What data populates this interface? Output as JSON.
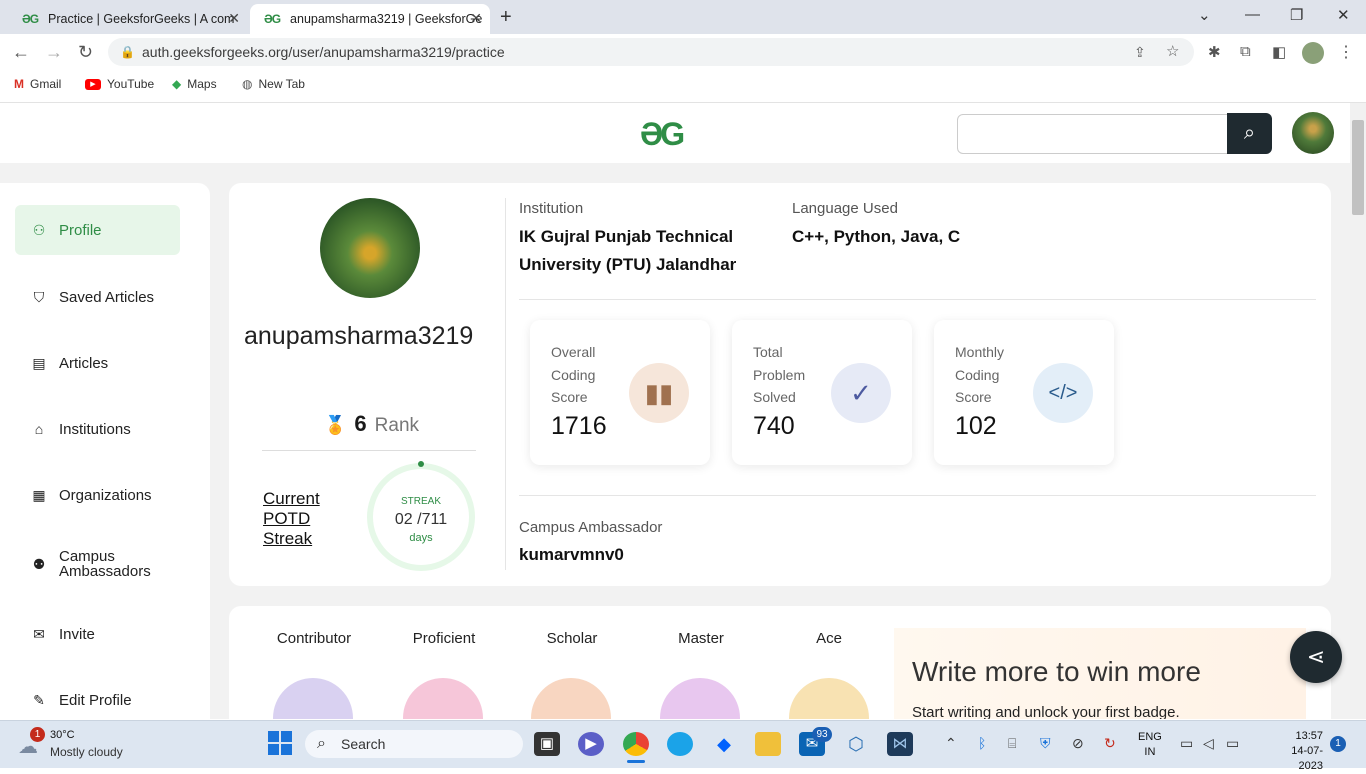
{
  "browser": {
    "tabs": [
      {
        "title": "Practice | GeeksforGeeks | A com",
        "favicon": "gfg-icon",
        "active": false
      },
      {
        "title": "anupamsharma3219 | GeeksforGe",
        "favicon": "gfg-icon",
        "active": true
      }
    ],
    "new_tab_symbol": "+",
    "url": "auth.geeksforgeeks.org/user/anupamsharma3219/practice",
    "bookmarks": [
      {
        "label": "Gmail",
        "icon": "gmail-icon"
      },
      {
        "label": "YouTube",
        "icon": "youtube-icon"
      },
      {
        "label": "Maps",
        "icon": "maps-icon"
      },
      {
        "label": "New Tab",
        "icon": "globe-icon"
      }
    ]
  },
  "site": {
    "logo_text": "ƏG",
    "search_placeholder": ""
  },
  "sidebar": {
    "items": [
      {
        "label": "Profile",
        "icon": "person-icon",
        "active": true
      },
      {
        "label": "Saved Articles",
        "icon": "bookmark-icon",
        "active": false
      },
      {
        "label": "Articles",
        "icon": "document-icon",
        "active": false
      },
      {
        "label": "Institutions",
        "icon": "graduation-cap-icon",
        "active": false
      },
      {
        "label": "Organizations",
        "icon": "building-icon",
        "active": false
      },
      {
        "label": "Campus Ambassadors",
        "icon": "people-icon",
        "active": false
      },
      {
        "label": "Invite",
        "icon": "mail-icon",
        "active": false
      },
      {
        "label": "Edit Profile",
        "icon": "pencil-icon",
        "active": false
      }
    ]
  },
  "profile": {
    "username": "anupamsharma3219",
    "rank_value": "6",
    "rank_label": "Rank",
    "potd_label": "Current POTD Streak",
    "streak_title": "STREAK",
    "streak_value": "02 /711",
    "streak_unit": "days",
    "institution_label": "Institution",
    "institution": "IK Gujral Punjab Technical University (PTU) Jalandhar",
    "language_label": "Language Used",
    "languages": "C++, Python, Java, C",
    "campus_label": "Campus Ambassador",
    "campus_ambassador": "kumarvmnv0",
    "stats": [
      {
        "label": "Overall Coding Score",
        "value": "1716",
        "icon": "bar-chart-icon",
        "icon_bg": "#f6e6da",
        "icon_color": "#a0714f"
      },
      {
        "label": "Total Problem Solved",
        "value": "740",
        "icon": "check-circle-icon",
        "icon_bg": "#e6eaf6",
        "icon_color": "#4d5aa0"
      },
      {
        "label": "Monthly Coding Score",
        "value": "102",
        "icon": "code-icon",
        "icon_bg": "#e3eef8",
        "icon_color": "#2a5b8c"
      }
    ]
  },
  "badges": [
    {
      "label": "Contributor",
      "color": "#d9d1f1"
    },
    {
      "label": "Proficient",
      "color": "#f6c6d9"
    },
    {
      "label": "Scholar",
      "color": "#f8d6c1"
    },
    {
      "label": "Master",
      "color": "#e8c7ef"
    },
    {
      "label": "Ace",
      "color": "#f8e2b2"
    }
  ],
  "promo": {
    "title": "Write more to win more",
    "subtitle": "Start writing and unlock your first badge."
  },
  "taskbar": {
    "weather_temp": "30°C",
    "weather_desc": "Mostly cloudy",
    "weather_badge": "1",
    "search_label": "Search",
    "mail_badge": "93",
    "lang_top": "ENG",
    "lang_bottom": "IN",
    "time": "13:57",
    "date": "14-07-2023",
    "notification_count": "1"
  }
}
